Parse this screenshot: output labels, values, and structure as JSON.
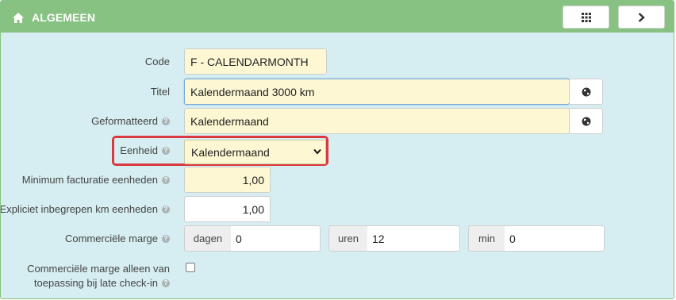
{
  "header": {
    "title": "ALGEMEEN",
    "icons": [
      "home-icon",
      "grid-icon",
      "chevron-right-icon"
    ]
  },
  "form": {
    "code": {
      "label": "Code",
      "value": "F - CALENDARMONTH"
    },
    "titel": {
      "label": "Titel",
      "value": "Kalendermaand 3000 km",
      "button_icon": "globe-icon"
    },
    "geformatteerd": {
      "label": "Geformatteerd",
      "value": "Kalendermaand",
      "button_icon": "globe-icon"
    },
    "eenheid": {
      "label": "Eenheid",
      "selected": "Kalendermaand"
    },
    "min_facturatie": {
      "label": "Minimum facturatie eenheden",
      "value": "1,00"
    },
    "expliciet_km": {
      "label": "Expliciet inbegrepen km eenheden",
      "value": "1,00"
    },
    "commerciele_marge": {
      "label": "Commerciële marge",
      "dagen": {
        "addon": "dagen",
        "value": "0"
      },
      "uren": {
        "addon": "uren",
        "value": "12"
      },
      "min": {
        "addon": "min",
        "value": "0"
      }
    },
    "late_checkin": {
      "label_line1": "Commerciële marge alleen van",
      "label_line2": "toepassing bij late check-in",
      "checked": false
    }
  },
  "colors": {
    "header_bg": "#87c283",
    "panel_bg": "#d6eef1",
    "input_bg": "#fdf8d3",
    "highlight_border": "#d9393f"
  }
}
